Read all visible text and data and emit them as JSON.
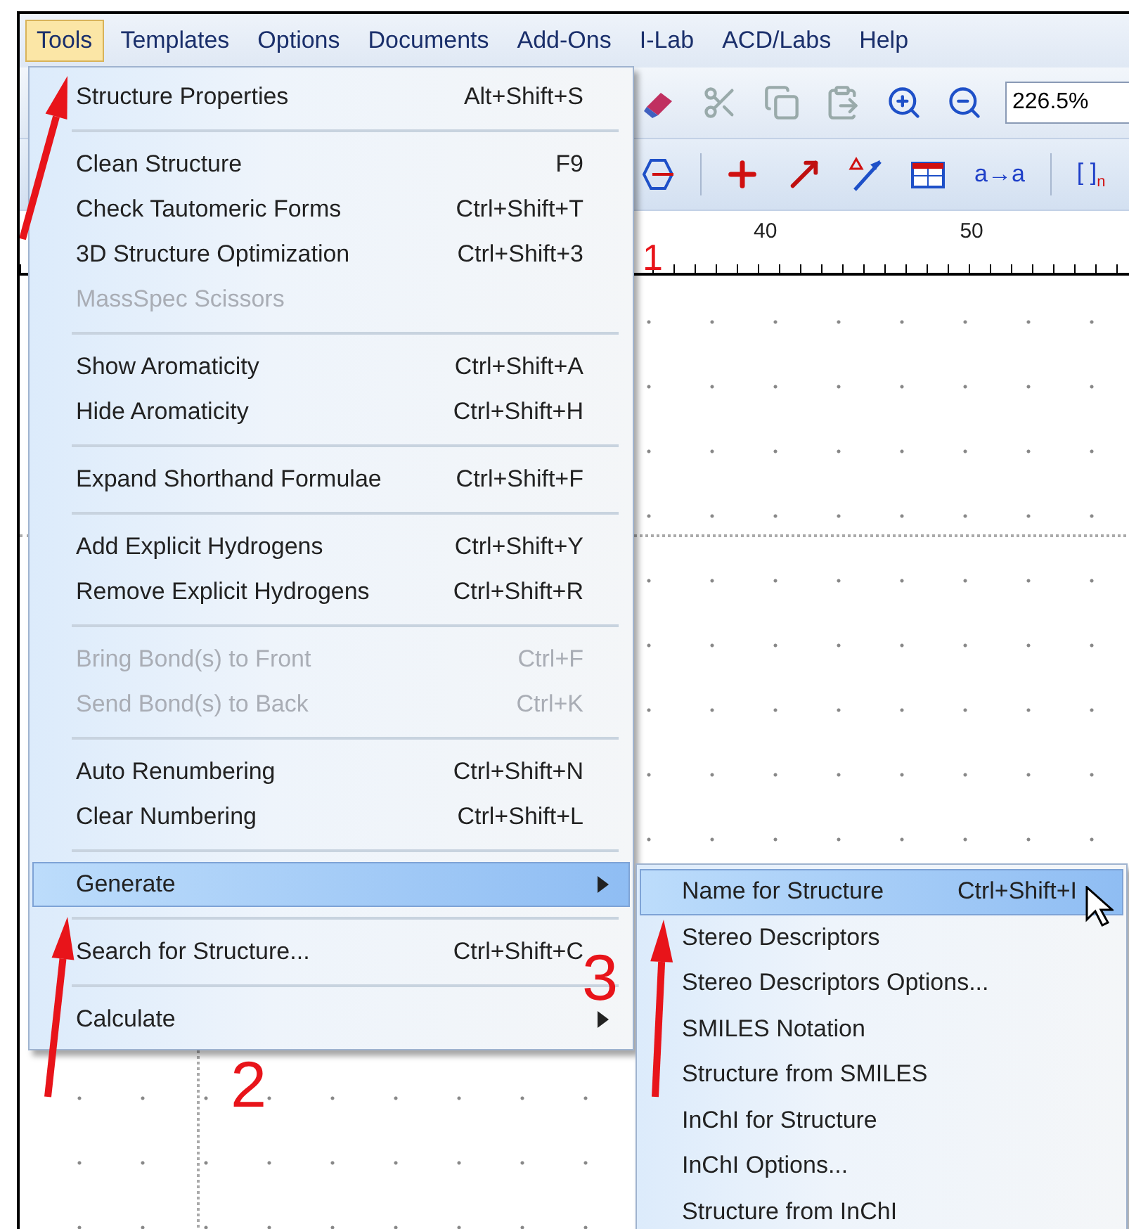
{
  "menu_bar": {
    "items": [
      {
        "label": "Tools",
        "selected": true
      },
      {
        "label": "Templates",
        "selected": false
      },
      {
        "label": "Options",
        "selected": false
      },
      {
        "label": "Documents",
        "selected": false
      },
      {
        "label": "Add-Ons",
        "selected": false
      },
      {
        "label": "I-Lab",
        "selected": false
      },
      {
        "label": "ACD/Labs",
        "selected": false
      },
      {
        "label": "Help",
        "selected": false
      }
    ]
  },
  "toolbar": {
    "zoom_field": {
      "value": "226.5%"
    },
    "atom_map_button": "a→a",
    "bracket_button": "[ ]$_{n}$"
  },
  "ruler": {
    "labels": [
      "40",
      "50"
    ]
  },
  "tools_menu": {
    "groups": [
      [
        {
          "label": "Structure Properties",
          "shortcut": "Alt+Shift+S",
          "disabled": false,
          "selected": false,
          "has_submenu": false
        }
      ],
      [
        {
          "label": "Clean Structure",
          "shortcut": "F9",
          "disabled": false,
          "selected": false,
          "has_submenu": false
        },
        {
          "label": "Check Tautomeric Forms",
          "shortcut": "Ctrl+Shift+T",
          "disabled": false,
          "selected": false,
          "has_submenu": false
        },
        {
          "label": "3D Structure Optimization",
          "shortcut": "Ctrl+Shift+3",
          "disabled": false,
          "selected": false,
          "has_submenu": false
        },
        {
          "label": "MassSpec Scissors",
          "disabled": true,
          "selected": false,
          "has_submenu": false
        }
      ],
      [
        {
          "label": "Show Aromaticity",
          "shortcut": "Ctrl+Shift+A",
          "disabled": false,
          "selected": false,
          "has_submenu": false
        },
        {
          "label": "Hide Aromaticity",
          "shortcut": "Ctrl+Shift+H",
          "disabled": false,
          "selected": false,
          "has_submenu": false
        }
      ],
      [
        {
          "label": "Expand Shorthand Formulae",
          "shortcut": "Ctrl+Shift+F",
          "disabled": false,
          "selected": false,
          "has_submenu": false
        }
      ],
      [
        {
          "label": "Add Explicit Hydrogens",
          "shortcut": "Ctrl+Shift+Y",
          "disabled": false,
          "selected": false,
          "has_submenu": false
        },
        {
          "label": "Remove Explicit Hydrogens",
          "shortcut": "Ctrl+Shift+R",
          "disabled": false,
          "selected": false,
          "has_submenu": false
        }
      ],
      [
        {
          "label": "Bring Bond(s) to Front",
          "shortcut": "Ctrl+F",
          "disabled": true,
          "selected": false,
          "has_submenu": false
        },
        {
          "label": "Send Bond(s) to Back",
          "shortcut": "Ctrl+K",
          "disabled": true,
          "selected": false,
          "has_submenu": false
        }
      ],
      [
        {
          "label": "Auto Renumbering",
          "shortcut": "Ctrl+Shift+N",
          "disabled": false,
          "selected": false,
          "has_submenu": false
        },
        {
          "label": "Clear Numbering",
          "shortcut": "Ctrl+Shift+L",
          "disabled": false,
          "selected": false,
          "has_submenu": false
        }
      ],
      [
        {
          "label": "Generate",
          "disabled": false,
          "selected": true,
          "has_submenu": true
        }
      ],
      [
        {
          "label": "Search for Structure...",
          "shortcut": "Ctrl+Shift+C",
          "disabled": false,
          "selected": false,
          "has_submenu": false
        }
      ],
      [
        {
          "label": "Calculate",
          "disabled": false,
          "selected": false,
          "has_submenu": true
        }
      ]
    ]
  },
  "generate_submenu": {
    "items": [
      {
        "label": "Name for Structure",
        "shortcut": "Ctrl+Shift+I",
        "selected": true
      },
      {
        "label": "Stereo Descriptors",
        "selected": false
      },
      {
        "label": "Stereo Descriptors Options...",
        "selected": false
      },
      {
        "label": "SMILES Notation",
        "selected": false
      },
      {
        "label": "Structure from SMILES",
        "selected": false
      },
      {
        "label": "InChI for Structure",
        "selected": false
      },
      {
        "label": "InChI Options...",
        "selected": false
      },
      {
        "label": "Structure from InChI",
        "selected": false
      }
    ]
  },
  "annotations": [
    {
      "label": "1"
    },
    {
      "label": "2"
    },
    {
      "label": "3"
    }
  ]
}
